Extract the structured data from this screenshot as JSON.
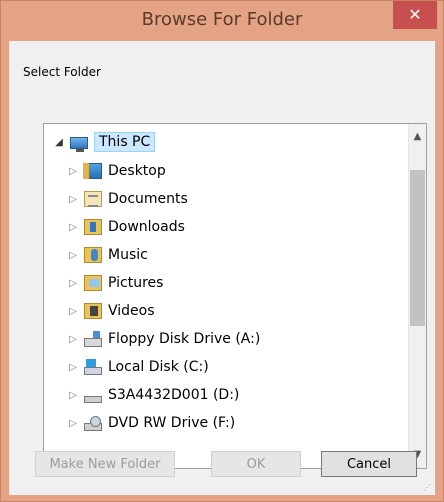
{
  "window": {
    "title": "Browse For Folder",
    "close_glyph": "✕"
  },
  "prompt": "Select Folder",
  "tree": {
    "root": {
      "label": "This PC",
      "icon": "computer-icon",
      "expanded": true,
      "selected": true
    },
    "items": [
      {
        "label": "Desktop",
        "icon": "desktop-folder-icon"
      },
      {
        "label": "Documents",
        "icon": "documents-folder-icon"
      },
      {
        "label": "Downloads",
        "icon": "downloads-folder-icon"
      },
      {
        "label": "Music",
        "icon": "music-folder-icon"
      },
      {
        "label": "Pictures",
        "icon": "pictures-folder-icon"
      },
      {
        "label": "Videos",
        "icon": "videos-folder-icon"
      },
      {
        "label": "Floppy Disk Drive (A:)",
        "icon": "floppy-drive-icon"
      },
      {
        "label": "Local Disk (C:)",
        "icon": "local-disk-icon"
      },
      {
        "label": "S3A4432D001 (D:)",
        "icon": "drive-icon"
      },
      {
        "label": "DVD RW Drive (F:)",
        "icon": "dvd-drive-icon"
      }
    ]
  },
  "buttons": {
    "make_new_folder": "Make New Folder",
    "ok": "OK",
    "cancel": "Cancel"
  },
  "colors": {
    "titlebar": "#e4a384",
    "close": "#c7504e",
    "selection": "#cce8ff"
  }
}
